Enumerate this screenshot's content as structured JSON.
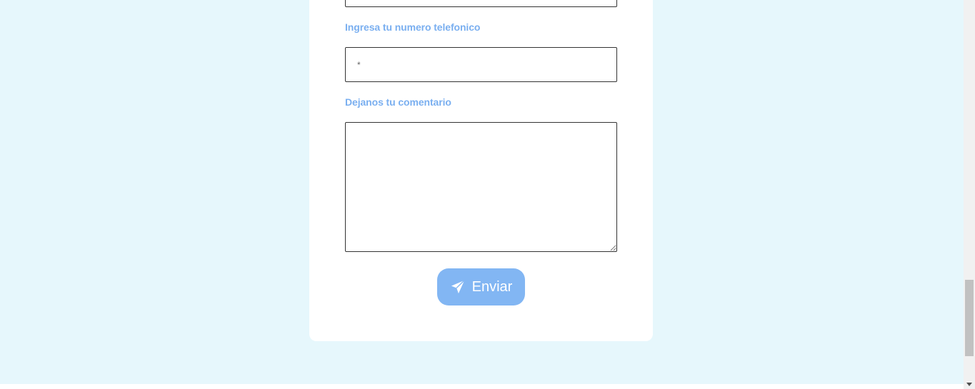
{
  "form": {
    "phone_label": "Ingresa tu numero telefonico",
    "phone_placeholder": "*",
    "phone_value": "",
    "comment_label": "Dejanos tu comentario",
    "comment_value": "",
    "submit_label": "Enviar",
    "submit_icon": "paper-plane-icon"
  },
  "colors": {
    "page_background": "#e6f7fc",
    "label_text": "#7aaff0",
    "button_background": "#82b6f3",
    "button_text": "#ffffff"
  }
}
